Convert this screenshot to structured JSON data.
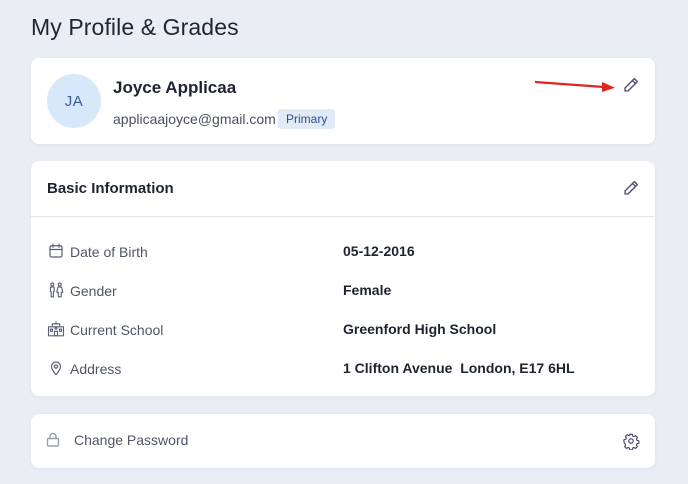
{
  "page": {
    "title": "My Profile & Grades"
  },
  "profile": {
    "initials": "JA",
    "name": "Joyce Applicaa",
    "email": "applicaajoyce@gmail.com",
    "badge": "Primary",
    "edit_icon": "pencil-icon",
    "annotation_arrow_color": "#e02424"
  },
  "basic_info": {
    "title": "Basic Information",
    "edit_icon": "pencil-icon",
    "rows": [
      {
        "icon": "calendar-icon",
        "label": "Date of Birth",
        "value": "05-12-2016"
      },
      {
        "icon": "people-icon",
        "label": "Gender",
        "value": "Female"
      },
      {
        "icon": "school-icon",
        "label": "Current School",
        "value": "Greenford High School"
      },
      {
        "icon": "location-pin-icon",
        "label": "Address",
        "value": "1 Clifton Avenue  London, E17 6HL"
      }
    ]
  },
  "security": {
    "label": "Change Password",
    "lock_icon": "lock-icon",
    "settings_icon": "gear-icon"
  },
  "colors": {
    "background": "#e9edf4",
    "card": "#ffffff",
    "avatar_bg": "#d8e8fb",
    "badge_bg": "#e1ebf8",
    "icon": "#4a5070"
  }
}
